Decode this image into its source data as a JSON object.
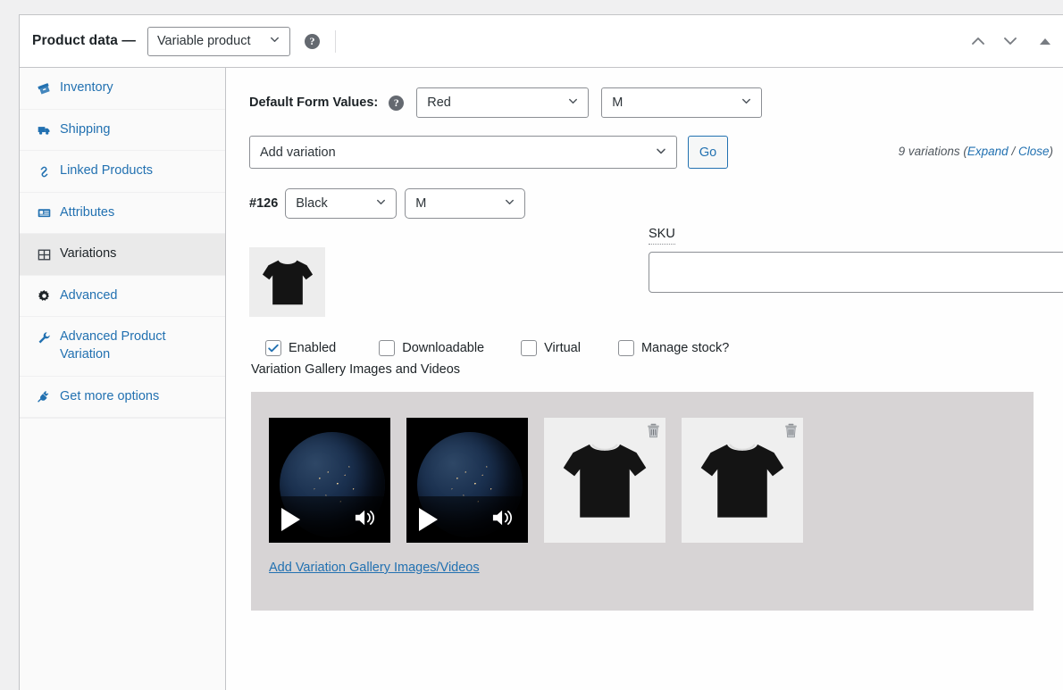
{
  "header": {
    "title": "Product data —",
    "product_type": "Variable product",
    "help_icon": "help-circle-icon",
    "up_icon": "chevron-up-icon",
    "down_icon": "chevron-down-icon",
    "collapse_icon": "triangle-up-icon"
  },
  "sidebar": {
    "items": [
      {
        "label": "Inventory",
        "icon": "archive-box-icon",
        "active": false
      },
      {
        "label": "Shipping",
        "icon": "truck-icon",
        "active": false
      },
      {
        "label": "Linked Products",
        "icon": "link-icon",
        "active": false
      },
      {
        "label": "Attributes",
        "icon": "id-card-icon",
        "active": false
      },
      {
        "label": "Variations",
        "icon": "grid-icon",
        "active": true
      },
      {
        "label": "Advanced",
        "icon": "gear-icon",
        "active": false
      },
      {
        "label": "Advanced Product Variation",
        "icon": "wrench-icon",
        "active": false
      },
      {
        "label": "Get more options",
        "icon": "plug-icon",
        "active": false
      }
    ]
  },
  "default_form_values": {
    "label": "Default Form Values:",
    "help_icon": "help-circle-icon",
    "color_value": "Red",
    "size_value": "M"
  },
  "add_variation": {
    "select_value": "Add variation",
    "go_label": "Go",
    "count_text": "9 variations",
    "expand_label": "Expand",
    "separator": "/",
    "close_label": "Close"
  },
  "variation": {
    "id": "#126",
    "color_value": "Black",
    "size_value": "M",
    "thumbnail_alt": "black-tshirt-thumbnail",
    "sku": {
      "label": "SKU",
      "value": "",
      "help_icon": "help-circle-icon"
    },
    "checkboxes": [
      {
        "label": "Enabled",
        "checked": true
      },
      {
        "label": "Downloadable",
        "checked": false
      },
      {
        "label": "Virtual",
        "checked": false
      },
      {
        "label": "Manage stock?",
        "checked": false
      }
    ],
    "gallery": {
      "title": "Variation Gallery Images and Videos",
      "items": [
        {
          "type": "video",
          "alt": "earth-at-night-video",
          "play_icon": "play-icon",
          "volume_icon": "volume-icon"
        },
        {
          "type": "video",
          "alt": "earth-at-night-video",
          "play_icon": "play-icon",
          "volume_icon": "volume-icon"
        },
        {
          "type": "image",
          "alt": "black-tshirt-image",
          "delete_icon": "trash-icon"
        },
        {
          "type": "image",
          "alt": "black-tshirt-image",
          "delete_icon": "trash-icon"
        }
      ],
      "add_link": "Add Variation Gallery Images/Videos"
    }
  },
  "colors": {
    "link": "#2271b1",
    "active_sidebar_bg": "#eaeaea",
    "gallery_bg": "#d7d4d5",
    "border": "#c3c4c7"
  }
}
